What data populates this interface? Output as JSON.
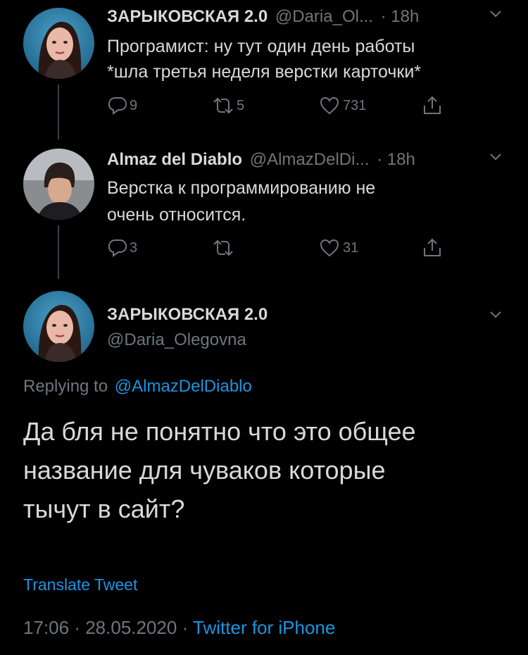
{
  "tweets": [
    {
      "name": "ЗАРЫКОВСКАЯ 2.0",
      "handle": "@Daria_Ol...",
      "sep": "·",
      "time": "18h",
      "line1": "Програмист: ну тут один день работы",
      "line2": "*шла третья неделя верстки карточки*",
      "replies": "9",
      "retweets": "5",
      "likes": "731"
    },
    {
      "name": "Almaz del Diablo",
      "handle": "@AlmazDelDi...",
      "sep": "·",
      "time": "18h",
      "line1": "Верстка к программированию не",
      "line2": "очень относится.",
      "replies": "3",
      "retweets": "",
      "likes": "31"
    }
  ],
  "main_tweet": {
    "name": "ЗАРЫКОВСКАЯ 2.0",
    "handle": "@Daria_Olegovna",
    "replying_prefix": "Replying to",
    "replying_to": "@AlmazDelDiablo",
    "text_lines": [
      "Да бля не понятно что это общее",
      "название для чуваков которые",
      "тычут в сайт?"
    ],
    "translate": "Translate Tweet",
    "time": "17:06",
    "dot1": "·",
    "date": "28.05.2020",
    "dot2": "·",
    "source": "Twitter for iPhone"
  },
  "colors": {
    "background": "#000000",
    "text": "#d9d9d9",
    "muted": "#6e767d",
    "link": "#1b95e0"
  },
  "icons": [
    "reply-icon",
    "retweet-icon",
    "like-icon",
    "share-icon",
    "chevron-down-icon"
  ]
}
